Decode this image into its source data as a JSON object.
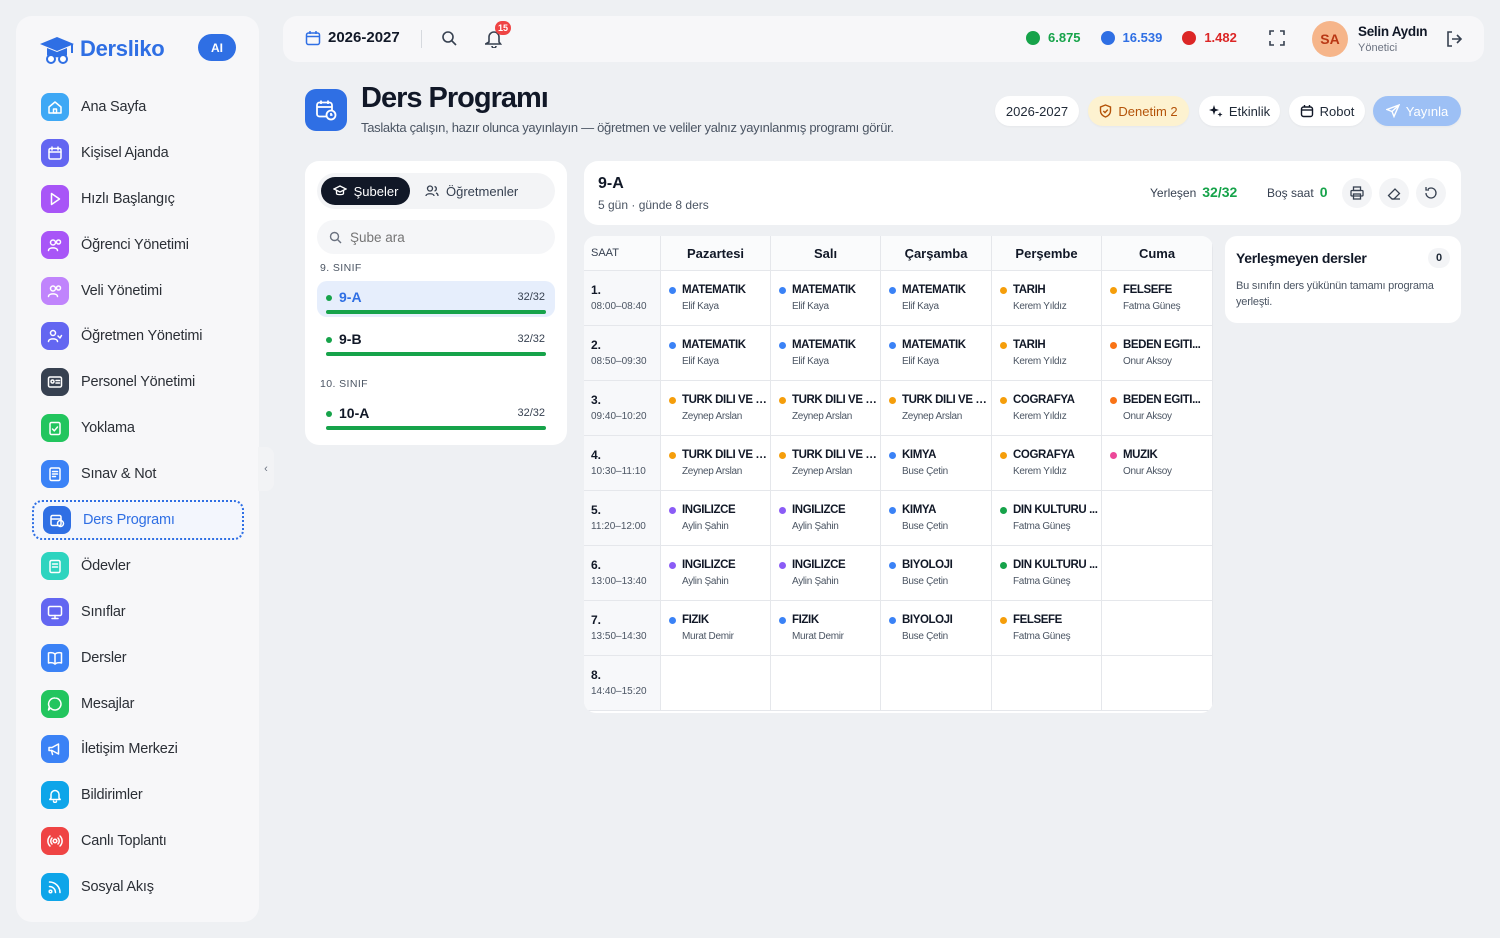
{
  "app": {
    "brand": "Dersliko",
    "ai_badge": "AI"
  },
  "sidebar": {
    "items": [
      {
        "label": "Ana Sayfa",
        "icon": "home-icon",
        "color": "#3ea8f5"
      },
      {
        "label": "Kişisel Ajanda",
        "icon": "calendar-icon",
        "color": "#6366f1"
      },
      {
        "label": "Hızlı Başlangıç",
        "icon": "play-icon",
        "color": "#a855f7"
      },
      {
        "label": "Öğrenci Yönetimi",
        "icon": "students-icon",
        "color": "#a855f7"
      },
      {
        "label": "Veli Yönetimi",
        "icon": "parents-icon",
        "color": "#c084fc"
      },
      {
        "label": "Öğretmen Yönetimi",
        "icon": "teacher-icon",
        "color": "#6366f1"
      },
      {
        "label": "Personel Yönetimi",
        "icon": "id-card-icon",
        "color": "#374151"
      },
      {
        "label": "Yoklama",
        "icon": "clipboard-check-icon",
        "color": "#22c55e"
      },
      {
        "label": "Sınav & Not",
        "icon": "exam-icon",
        "color": "#3b82f6"
      },
      {
        "label": "Ders Programı",
        "icon": "schedule-icon",
        "color": "#2f6fe4",
        "active": true
      },
      {
        "label": "Ödevler",
        "icon": "homework-icon",
        "color": "#2dd4bf"
      },
      {
        "label": "Sınıflar",
        "icon": "classroom-icon",
        "color": "#6366f1"
      },
      {
        "label": "Dersler",
        "icon": "book-icon",
        "color": "#3b82f6"
      },
      {
        "label": "Mesajlar",
        "icon": "message-icon",
        "color": "#22c55e"
      },
      {
        "label": "İletişim Merkezi",
        "icon": "megaphone-icon",
        "color": "#3b82f6"
      },
      {
        "label": "Bildirimler",
        "icon": "bell-icon",
        "color": "#0ea5e9"
      },
      {
        "label": "Canlı Toplantı",
        "icon": "live-icon",
        "color": "#ef4444"
      },
      {
        "label": "Sosyal Akış",
        "icon": "rss-icon",
        "color": "#0ea5e9"
      }
    ]
  },
  "topbar": {
    "year": "2026-2027",
    "notification_count": "15",
    "coins": [
      {
        "value": "6.875",
        "color": "#16a34a",
        "icon": "green-coin-icon"
      },
      {
        "value": "16.539",
        "color": "#2f6fe4",
        "icon": "blue-gem-icon"
      },
      {
        "value": "1.482",
        "color": "#dc2626",
        "icon": "flame-icon"
      }
    ],
    "user": {
      "initials": "SA",
      "name": "Selin Aydın",
      "role": "Yönetici"
    }
  },
  "page": {
    "title": "Ders Programı",
    "subtitle": "Taslakta çalışın, hazır olunca yayınlayın — öğretmen ve veliler yalnız yayınlanmış programı görür.",
    "buttons": {
      "year": "2026-2027",
      "audit": "Denetim 2",
      "activity": "Etkinlik",
      "robot": "Robot",
      "publish": "Yayınla"
    }
  },
  "left_panel": {
    "tabs": {
      "classes": "Şubeler",
      "teachers": "Öğretmenler"
    },
    "search_placeholder": "Şube ara",
    "groups": [
      {
        "label": "9. SINIF",
        "classes": [
          {
            "name": "9-A",
            "count": "32/32",
            "active": true
          },
          {
            "name": "9-B",
            "count": "32/32"
          }
        ]
      },
      {
        "label": "10. SINIF",
        "classes": [
          {
            "name": "10-A",
            "count": "32/32"
          }
        ]
      }
    ]
  },
  "class_card": {
    "name": "9-A",
    "sub": "5 gün · günde 8 ders",
    "placed_label": "Yerleşen",
    "placed_value": "32/32",
    "empty_label": "Boş saat",
    "empty_value": "0"
  },
  "schedule": {
    "time_header": "SAAT",
    "days": [
      "Pazartesi",
      "Salı",
      "Çarşamba",
      "Perşembe",
      "Cuma"
    ],
    "periods": [
      {
        "no": "1.",
        "time": "08:00–08:40"
      },
      {
        "no": "2.",
        "time": "08:50–09:30"
      },
      {
        "no": "3.",
        "time": "09:40–10:20"
      },
      {
        "no": "4.",
        "time": "10:30–11:10"
      },
      {
        "no": "5.",
        "time": "11:20–12:00"
      },
      {
        "no": "6.",
        "time": "13:00–13:40"
      },
      {
        "no": "7.",
        "time": "13:50–14:30"
      },
      {
        "no": "8.",
        "time": "14:40–15:20"
      }
    ],
    "cells": [
      [
        {
          "s": "MATEMATİK",
          "t": "Elif Kaya",
          "c": "#3b82f6"
        },
        {
          "s": "MATEMATİK",
          "t": "Elif Kaya",
          "c": "#3b82f6"
        },
        {
          "s": "MATEMATİK",
          "t": "Elif Kaya",
          "c": "#3b82f6"
        },
        {
          "s": "TARİH",
          "t": "Kerem Yıldız",
          "c": "#f59e0b"
        },
        {
          "s": "FELSEFE",
          "t": "Fatma Güneş",
          "c": "#f59e0b"
        }
      ],
      [
        {
          "s": "MATEMATİK",
          "t": "Elif Kaya",
          "c": "#3b82f6"
        },
        {
          "s": "MATEMATİK",
          "t": "Elif Kaya",
          "c": "#3b82f6"
        },
        {
          "s": "MATEMATİK",
          "t": "Elif Kaya",
          "c": "#3b82f6"
        },
        {
          "s": "TARİH",
          "t": "Kerem Yıldız",
          "c": "#f59e0b"
        },
        {
          "s": "BEDEN EĞİTİ...",
          "t": "Onur Aksoy",
          "c": "#f97316"
        }
      ],
      [
        {
          "s": "TÜRK DİLİ VE E...",
          "t": "Zeynep Arslan",
          "c": "#f59e0b"
        },
        {
          "s": "TÜRK DİLİ VE E...",
          "t": "Zeynep Arslan",
          "c": "#f59e0b"
        },
        {
          "s": "TÜRK DİLİ VE E...",
          "t": "Zeynep Arslan",
          "c": "#f59e0b"
        },
        {
          "s": "COĞRAFYA",
          "t": "Kerem Yıldız",
          "c": "#f59e0b"
        },
        {
          "s": "BEDEN EĞİTİ...",
          "t": "Onur Aksoy",
          "c": "#f97316"
        }
      ],
      [
        {
          "s": "TÜRK DİLİ VE E...",
          "t": "Zeynep Arslan",
          "c": "#f59e0b"
        },
        {
          "s": "TÜRK DİLİ VE E...",
          "t": "Zeynep Arslan",
          "c": "#f59e0b"
        },
        {
          "s": "KİMYA",
          "t": "Buse Çetin",
          "c": "#3b82f6"
        },
        {
          "s": "COĞRAFYA",
          "t": "Kerem Yıldız",
          "c": "#f59e0b"
        },
        {
          "s": "MÜZİK",
          "t": "Onur Aksoy",
          "c": "#ec4899"
        }
      ],
      [
        {
          "s": "İNGİLİZCE",
          "t": "Aylin Şahin",
          "c": "#8b5cf6"
        },
        {
          "s": "İNGİLİZCE",
          "t": "Aylin Şahin",
          "c": "#8b5cf6"
        },
        {
          "s": "KİMYA",
          "t": "Buse Çetin",
          "c": "#3b82f6"
        },
        {
          "s": "DİN KÜLTÜRÜ ...",
          "t": "Fatma Güneş",
          "c": "#16a34a"
        },
        null
      ],
      [
        {
          "s": "İNGİLİZCE",
          "t": "Aylin Şahin",
          "c": "#8b5cf6"
        },
        {
          "s": "İNGİLİZCE",
          "t": "Aylin Şahin",
          "c": "#8b5cf6"
        },
        {
          "s": "BİYOLOJİ",
          "t": "Buse Çetin",
          "c": "#3b82f6"
        },
        {
          "s": "DİN KÜLTÜRÜ ...",
          "t": "Fatma Güneş",
          "c": "#16a34a"
        },
        null
      ],
      [
        {
          "s": "FİZİK",
          "t": "Murat Demir",
          "c": "#3b82f6"
        },
        {
          "s": "FİZİK",
          "t": "Murat Demir",
          "c": "#3b82f6"
        },
        {
          "s": "BİYOLOJİ",
          "t": "Buse Çetin",
          "c": "#3b82f6"
        },
        {
          "s": "FELSEFE",
          "t": "Fatma Güneş",
          "c": "#f59e0b"
        },
        null
      ],
      [
        null,
        null,
        null,
        null,
        null
      ]
    ]
  },
  "unplaced": {
    "title": "Yerleşmeyen dersler",
    "count": "0",
    "text": "Bu sınıfın ders yükünün tamamı programa yerleşti."
  }
}
